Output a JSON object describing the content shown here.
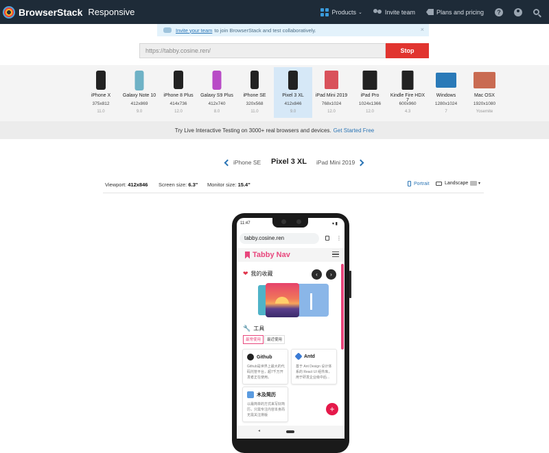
{
  "topnav": {
    "brand": "BrowserStack",
    "product": "Responsive",
    "products_label": "Products",
    "invite_label": "Invite team",
    "pricing_label": "Plans and pricing",
    "help_icon": "help-icon",
    "account_icon": "account-icon",
    "search_icon": "search-icon"
  },
  "invite_banner": {
    "link": "Invite your team",
    "text": "to join BrowserStack and test collaboratively.",
    "close": "×"
  },
  "urlbar": {
    "value": "https://tabby.cosine.ren/",
    "stop_label": "Stop"
  },
  "devices": [
    {
      "name": "iPhone X",
      "res": "375x812",
      "os": "11.0"
    },
    {
      "name": "Galaxy Note 10",
      "res": "412x869",
      "os": "9.0"
    },
    {
      "name": "iPhone 8 Plus",
      "res": "414x736",
      "os": "12.0"
    },
    {
      "name": "Galaxy S9 Plus",
      "res": "412x740",
      "os": "8.0"
    },
    {
      "name": "iPhone SE",
      "res": "320x568",
      "os": "11.0"
    },
    {
      "name": "Pixel 3 XL",
      "res": "412x846",
      "os": "9.0"
    },
    {
      "name": "iPad Mini 2019",
      "res": "768x1024",
      "os": "12.0"
    },
    {
      "name": "iPad Pro",
      "res": "1024x1366",
      "os": "12.0"
    },
    {
      "name": "Kindle Fire HDX 7",
      "res": "600x960",
      "os": "4.3"
    },
    {
      "name": "Windows",
      "res": "1280x1024",
      "os": "7"
    },
    {
      "name": "Mac OSX",
      "res": "1920x1080",
      "os": "Yosemite"
    }
  ],
  "livebar": {
    "text": "Try Live Interactive Testing on 3000+ real browsers and devices.",
    "link": "Get Started Free"
  },
  "switcher": {
    "prev": "iPhone SE",
    "current": "Pixel 3 XL",
    "next": "iPad Mini 2019"
  },
  "info": {
    "viewport_label": "Viewport:",
    "viewport": "412x846",
    "screen_label": "Screen size:",
    "screen": "6.3\"",
    "monitor_label": "Monitor size:",
    "monitor": "15.4\"",
    "portrait": "Portrait",
    "landscape": "Landscape"
  },
  "phone": {
    "time": "11:47",
    "status_right": "▾ ▮",
    "address": "tabby.cosine.ren",
    "app_title": "Tabby Nav",
    "favorites_title": "我的收藏",
    "tools_title": "工具",
    "tab_active": "最常使用",
    "tab_other": "最近使用",
    "cards": [
      {
        "title": "Github",
        "desc": "Github是世界上最大的代码托管平台，超7千万开发者正在使用。"
      },
      {
        "title": "Antd",
        "desc": "基于 Ant Design 设计体系的 React UI 组件库，用于研发企业级中后..."
      },
      {
        "title": "木及简历",
        "desc": "以最简单的方式来写好简历，只需专注内容本身而无需关注排版"
      }
    ],
    "fab": "+",
    "nav_back": "◂"
  },
  "colors": {
    "nav_bg": "#1e2b38",
    "stop_red": "#e1342f",
    "accent_blue": "#2b75b5",
    "brand_pink": "#e8467c"
  }
}
